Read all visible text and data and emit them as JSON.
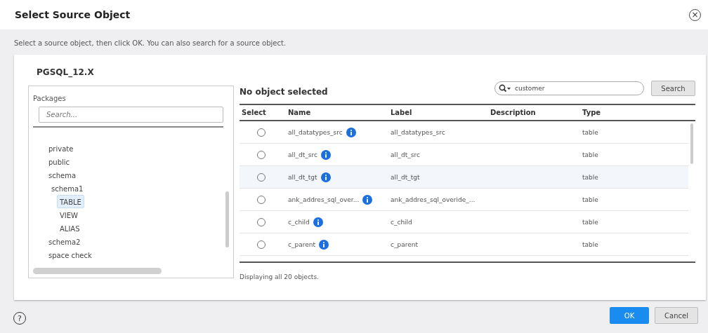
{
  "dialog": {
    "title": "Select Source Object",
    "close": "×",
    "instructions": "Select a source object, then click OK. You can also search for a source object."
  },
  "connection": "PGSQL_12.X",
  "packages": {
    "label": "Packages",
    "placeholder": "Search...",
    "items": [
      {
        "label": "private",
        "selected": false
      },
      {
        "label": "public",
        "selected": false
      },
      {
        "label": "schema",
        "selected": false,
        "children": [
          {
            "label": "schema1",
            "selected": false,
            "children": [
              {
                "label": "TABLE",
                "selected": true
              },
              {
                "label": "VIEW",
                "selected": false
              },
              {
                "label": "ALIAS",
                "selected": false
              }
            ]
          }
        ]
      },
      {
        "label": "schema2",
        "selected": false
      },
      {
        "label": "space check",
        "selected": false
      }
    ]
  },
  "objects": {
    "heading": "No object selected",
    "search_value": "customer",
    "search_button": "Search",
    "columns": [
      "Select",
      "Name",
      "Label",
      "Description",
      "Type"
    ],
    "rows": [
      {
        "selected": false,
        "hovered": false,
        "name": "all_datatypes_src",
        "label": "all_datatypes_src",
        "type": "table"
      },
      {
        "selected": false,
        "hovered": false,
        "name": "all_dt_src",
        "label": "all_dt_src",
        "type": "table"
      },
      {
        "selected": false,
        "hovered": true,
        "name": "all_dt_tgt",
        "label": "all_dt_tgt",
        "type": "table"
      },
      {
        "selected": false,
        "hovered": false,
        "name": "ank_addres_sql_over...",
        "label": "ank_addres_sql_overide_...",
        "type": "table"
      },
      {
        "selected": false,
        "hovered": false,
        "name": "c_child",
        "label": "c_child",
        "type": "table"
      },
      {
        "selected": false,
        "hovered": false,
        "name": "c_parent",
        "label": "c_parent",
        "type": "table"
      }
    ],
    "footer": "Displaying all 20 objects."
  },
  "help": "?",
  "buttons": [
    {
      "label": "OK",
      "kind": "primary"
    },
    {
      "label": "Cancel",
      "kind": "secondary"
    }
  ]
}
